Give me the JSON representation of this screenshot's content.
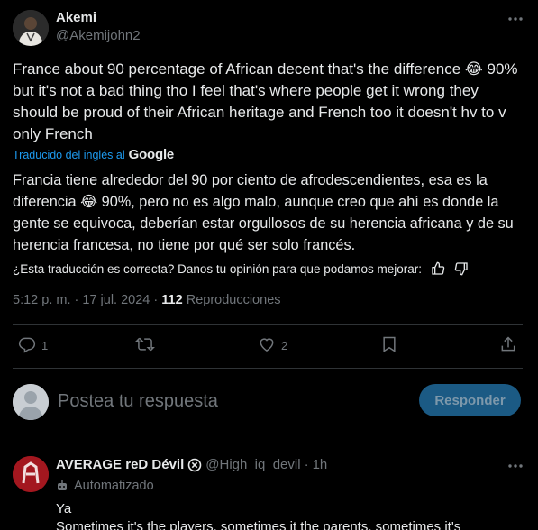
{
  "post": {
    "author_name": "Akemi",
    "author_handle": "@Akemijohn2",
    "text": "France about 90 percentage of African decent that's the difference 😂 90% but it's not a bad thing tho I feel that's where people get it wrong they should be proud of their African heritage and French too it doesn't hv to v only French",
    "translated_by": "Traducido del inglés al",
    "translator_brand": "Google",
    "translation": "Francia tiene alrededor del 90 por ciento de afrodescendientes, esa es la diferencia 😂 90%, pero no es algo malo, aunque creo que ahí es donde la gente se equivoca, deberían estar orgullosos de su herencia africana y de su herencia francesa, no tiene por qué ser solo francés.",
    "feedback_prompt": "¿Esta traducción es correcta? Danos tu opinión para que podamos mejorar:",
    "time": "5:12 p. m.",
    "date": "17 jul. 2024",
    "views_count": "112",
    "views_label": "Reproducciones",
    "separator": "·"
  },
  "actions": {
    "replies": "1",
    "reposts": "",
    "likes": "2"
  },
  "reply_composer": {
    "placeholder": "Postea tu respuesta",
    "button_label": "Responder"
  },
  "reply": {
    "author_name": "AVERAGE reD  Dévil",
    "author_handle": "@High_iq_devil",
    "separator": "·",
    "time": "1h",
    "automated_label": "Automatizado",
    "line1": "Ya",
    "line2": "Sometimes it's the players, sometimes it the parents, sometimes it's"
  },
  "colors": {
    "background": "#000000",
    "text": "#e7e9ea",
    "muted": "#71767b",
    "accent": "#1d9bf0",
    "divider": "#2f3336",
    "reply_button_bg": "#1b5a84"
  }
}
